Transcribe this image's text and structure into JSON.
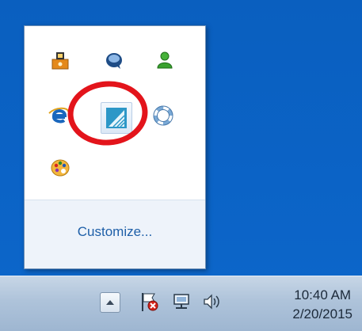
{
  "popup": {
    "customize_label": "Customize..."
  },
  "tray_icons": [
    {
      "name": "network-share-icon",
      "color": "#f09a1a"
    },
    {
      "name": "chat-bubble-icon",
      "color": "#1f4f86"
    },
    {
      "name": "user-green-icon",
      "color": "#3aa12f"
    },
    {
      "name": "ie-browser-icon",
      "color": "#1b6fc6"
    },
    {
      "name": "blue-app-icon",
      "color": "#2f9bc9"
    },
    {
      "name": "lifebuoy-icon",
      "color": "#6a9fd1"
    },
    {
      "name": "palette-icon",
      "color": "#f1b33a"
    }
  ],
  "annotation": {
    "highlight_color": "#e3141b"
  },
  "taskbar": {
    "time": "10:40 AM",
    "date": "2/20/2015"
  }
}
